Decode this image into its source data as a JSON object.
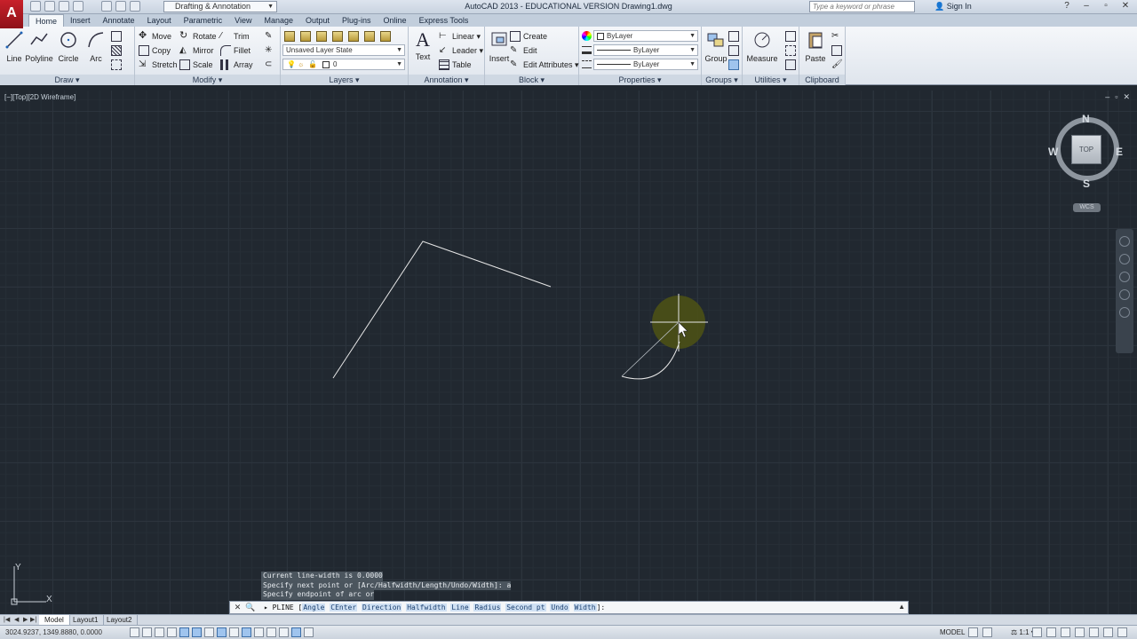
{
  "titlebar": {
    "window_title": "AutoCAD 2013 - EDUCATIONAL VERSION    Drawing1.dwg",
    "workspace": "Drafting & Annotation",
    "search_placeholder": "Type a keyword or phrase",
    "signin": "Sign In",
    "app_logo": "A"
  },
  "ribbon_tabs": [
    "Home",
    "Insert",
    "Annotate",
    "Layout",
    "Parametric",
    "View",
    "Manage",
    "Output",
    "Plug-ins",
    "Online",
    "Express Tools"
  ],
  "ribbon": {
    "draw": {
      "title": "Draw",
      "line": "Line",
      "polyline": "Polyline",
      "circle": "Circle",
      "arc": "Arc"
    },
    "modify": {
      "title": "Modify",
      "move": "Move",
      "rotate": "Rotate",
      "trim": "Trim",
      "copy": "Copy",
      "mirror": "Mirror",
      "fillet": "Fillet",
      "stretch": "Stretch",
      "scale": "Scale",
      "array": "Array"
    },
    "layers": {
      "title": "Layers",
      "layer_state": "Unsaved Layer State",
      "current_layer": "0"
    },
    "annotation": {
      "title": "Annotation",
      "text": "Text",
      "linear": "Linear",
      "leader": "Leader",
      "table": "Table"
    },
    "block": {
      "title": "Block",
      "insert": "Insert",
      "create": "Create",
      "edit": "Edit",
      "edit_attributes": "Edit Attributes"
    },
    "properties": {
      "title": "Properties",
      "color": "ByLayer",
      "linetype": "ByLayer",
      "lineweight": "ByLayer"
    },
    "groups": {
      "title": "Groups",
      "group": "Group"
    },
    "utilities": {
      "title": "Utilities",
      "measure": "Measure"
    },
    "clipboard": {
      "title": "Clipboard",
      "paste": "Paste"
    }
  },
  "viewport": {
    "label": "[−][Top][2D Wireframe]",
    "viewcube_face": "TOP",
    "compass": {
      "n": "N",
      "s": "S",
      "e": "E",
      "w": "W"
    },
    "wcs": "WCS",
    "ucs_x": "X",
    "ucs_y": "Y"
  },
  "command": {
    "history": [
      "Current line-width is 0.0000",
      "Specify next point or [Arc/Halfwidth/Length/Undo/Width]: a",
      "Specify endpoint of arc or"
    ],
    "prompt_cmd": "PLINE [",
    "options": [
      "Angle",
      "CEnter",
      "Direction",
      "Halfwidth",
      "Line",
      "Radius",
      "Second pt",
      "Undo",
      "Width"
    ],
    "prompt_end": "]:"
  },
  "layout_tabs": [
    "Model",
    "Layout1",
    "Layout2"
  ],
  "statusbar": {
    "coords": "3024.9237, 1349.8880, 0.0000",
    "model": "MODEL",
    "scale": "1:1"
  },
  "colors": {
    "background": "#212830",
    "geometry": "#e6e6e6",
    "cursor_highlight": "#4d5214"
  }
}
